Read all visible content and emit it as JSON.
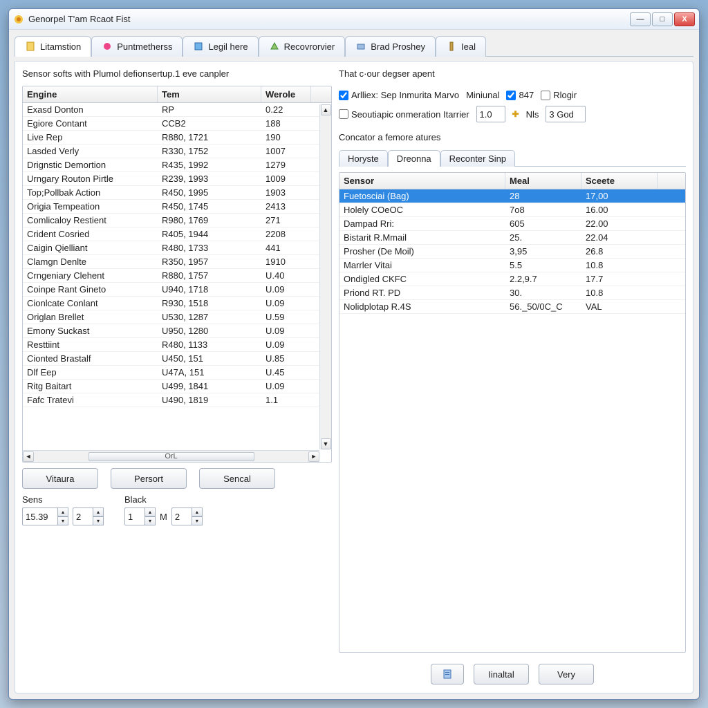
{
  "window": {
    "title": "Genorpel T'am Rcaot Fist"
  },
  "tabs": [
    {
      "label": "Litamstion",
      "active": true
    },
    {
      "label": "Puntmetherss"
    },
    {
      "label": "Legil here"
    },
    {
      "label": "Recovrorvier"
    },
    {
      "label": "Brad Proshey"
    },
    {
      "label": "Ieal"
    }
  ],
  "left": {
    "title": "Sensor softs with Plumol defionsertup.1 eve canpler",
    "cols": [
      "Engine",
      "Tem",
      "Werole"
    ],
    "rows": [
      [
        "Exasd Donton",
        "RP",
        "0.22"
      ],
      [
        "Egiore Contant",
        "CCB2",
        "188"
      ],
      [
        "Live Rep",
        "R880, 1721",
        "190"
      ],
      [
        "Lasded Verly",
        "R330, 1752",
        "1007"
      ],
      [
        "Drignstic Demortion",
        "R435, 1992",
        "1279"
      ],
      [
        "Urngary Routon Pirtle",
        "R239, 1993",
        "1009"
      ],
      [
        "Top;Pollbak Action",
        "R450, 1995",
        "1903"
      ],
      [
        "Origia Tempeation",
        "R450, 1745",
        "2413"
      ],
      [
        "Comlicaloy Restient",
        "R980, 1769",
        "271"
      ],
      [
        "Crident Cosried",
        "R405, 1944",
        "2208"
      ],
      [
        "Caigin Qielliant",
        "R480, 1733",
        "441"
      ],
      [
        "Clamgn Denlte",
        "R350, 1957",
        "1910"
      ],
      [
        "Crngeniary Clehent",
        "R880, 1757",
        "U.40"
      ],
      [
        "Coinpe Rant Gineto",
        "U940, 1718",
        "U.09"
      ],
      [
        "Cionlcate Conlant",
        "R930, 1518",
        "U.09"
      ],
      [
        "Origlan Brellet",
        "U530, 1287",
        "U.59"
      ],
      [
        "Emony Suckast",
        "U950, 1280",
        "U.09"
      ],
      [
        "Resttiint",
        "R480, 1133",
        "U.09"
      ],
      [
        "Cionted Brastalf",
        "U450, 151",
        "U.85"
      ],
      [
        "Dlf Eep",
        "U47A, 151",
        "U.45"
      ],
      [
        "Ritg Baitart",
        "U499, 1841",
        "U.09"
      ],
      [
        "Fafc Tratevi",
        "U490, 1819",
        "1.1"
      ]
    ],
    "hscroll_label": "OrL",
    "buttons": [
      "Vitaura",
      "Persort",
      "Sencal"
    ],
    "spin_groups": [
      {
        "label": "Sens",
        "vals": [
          "15.39",
          "2"
        ]
      },
      {
        "label": "Black",
        "vals": [
          "1",
          "2"
        ],
        "mid": "M"
      }
    ]
  },
  "right": {
    "title": "That c·our degser apent",
    "opts": {
      "check1": "Arlliex: Sep Inmurita Marvo",
      "minual": "Miniunal",
      "num1": "847",
      "rlog": "Rlogir",
      "sec": "Seoutiapic onmeration Itarrier",
      "val1": "1.0",
      "nls": "Nls",
      "god": "3 God"
    },
    "sub_title": "Concator a femore atures",
    "subtabs": [
      "Horyste",
      "Dreonna",
      "Reconter Sinp"
    ],
    "subtab_active": 1,
    "sensor_cols": [
      "Sensor",
      "Meal",
      "Sceete"
    ],
    "sensor_rows": [
      [
        "Fuetosciai (Bag)",
        "28",
        "17,00"
      ],
      [
        "Holely COeOC",
        "7o8",
        "16.00"
      ],
      [
        "Dampad Rri:",
        "605",
        "22.00"
      ],
      [
        "Bistarit R.Mmail",
        "25.",
        "22.04"
      ],
      [
        "Prosher (De Moil)",
        "3,95",
        "26.8"
      ],
      [
        "Marrler Vitai",
        "5.5",
        "10.8"
      ],
      [
        "Ondigled CKFC",
        "2.2,9.7",
        "17.7"
      ],
      [
        "Priond RT. PD",
        "30.",
        "10.8"
      ],
      [
        "Nolidplotap R.4S",
        "56._50/0C_C",
        "VAL"
      ]
    ],
    "selected_row": 0,
    "bottom": {
      "btn1": "Iinaltal",
      "btn2": "Very"
    }
  }
}
